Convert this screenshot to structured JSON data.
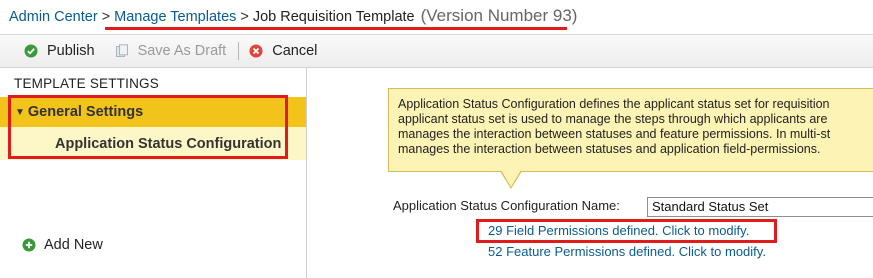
{
  "breadcrumb": {
    "admin_center": "Admin Center",
    "separator": ">",
    "manage_templates": "Manage Templates",
    "current": "Job Requisition Template",
    "version": "(Version Number 93)"
  },
  "toolbar": {
    "publish_label": "Publish",
    "save_draft_label": "Save As Draft",
    "cancel_label": "Cancel"
  },
  "left_panel": {
    "title": "TEMPLATE SETTINGS",
    "general_settings": "General Settings",
    "application_status_configuration": "Application Status Configuration",
    "add_new": "Add New"
  },
  "tooltip": {
    "lines": [
      "Application Status Configuration defines the applicant status set for requisition",
      "applicant status set is used to manage the steps through which applicants are",
      "manages the interaction between statuses and feature permissions. In multi-st",
      "manages the interaction between statuses and application field-permissions."
    ]
  },
  "config": {
    "label": "Application Status Configuration Name:",
    "selected_value": "Standard Status Set"
  },
  "links": {
    "field_permissions": "29 Field Permissions defined. Click to modify.",
    "feature_permissions": "52 Feature Permissions defined. Click to modify."
  },
  "colors": {
    "link": "#0a5b91",
    "highlight_red": "#e01b1b",
    "general_settings_bg": "#f1c31b",
    "selected_item_bg": "#fdf7c8",
    "tooltip_bg": "#fdf3b4",
    "publish_icon": "#3a9a3a",
    "cancel_icon": "#e0443a"
  },
  "icons": {
    "publish": "check-circle-icon",
    "save_draft": "document-icon",
    "cancel": "x-circle-icon",
    "expand": "triangle-down-icon",
    "add_new": "plus-circle-icon"
  }
}
